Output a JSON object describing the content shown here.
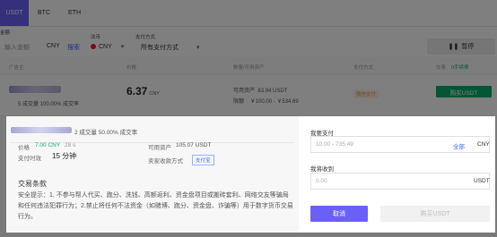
{
  "tabs": [
    "USDT",
    "BTC",
    "ETH"
  ],
  "filters": {
    "amount_label": "金额",
    "amount_placeholder": "输入金额",
    "amount_currency": "CNY",
    "search_label": "搜索",
    "fiat_label": "法币",
    "fiat_value": "CNY",
    "payment_label": "支付方式",
    "payment_value": "所有支付方式",
    "pause_label": "暂停"
  },
  "columns": {
    "advertiser": "广告主",
    "price": "价格",
    "available": "数量/可用资产",
    "payment": "支付方式",
    "action": "交易",
    "fee": "0手续费"
  },
  "row": {
    "orders": "5 成交量  100.00% 成交率",
    "price": "6.37",
    "price_unit": "CNY",
    "available_label": "可用资产",
    "available_value": "83.94 USDT",
    "limit_label": "限额",
    "limit_value": "￥100.00 - ￥534.69",
    "payment_badge": "微信支付",
    "buy_label": "购买USDT"
  },
  "modal": {
    "merchant_stats": "2 成交量  50.00% 成交率",
    "price_label": "价格",
    "price_value": "7.00 CNY",
    "price_time": "28 s",
    "pay_limit_label": "支付时效",
    "pay_limit_value": "15 分钟",
    "available_label": "可用资产",
    "available_value": "105.07 USDT",
    "seller_payment_label": "卖家收款方式",
    "seller_payment_value": "支付宝",
    "terms_title": "交易条款",
    "terms_body": "安全提示：1. 不参与帮人代买、跑分、洗钱、高额返利、资金盘项目或搬砖套利、网络交友等骗局和任何违法犯罪行为；2.禁止将任何不法资金（如赌博、跑分、资金盘、诈骗等）用于数字货币交易行为。",
    "pay_label": "我要支付",
    "pay_placeholder": "10.00 - 735.49",
    "pay_all": "全部",
    "pay_currency": "CNY",
    "receive_label": "我将收到",
    "receive_placeholder": "0.00",
    "receive_currency": "USDT",
    "cancel_label": "取消",
    "buy_label": "购买USDT"
  },
  "colors": {
    "accent": "#6a60f7",
    "green": "#0aad6d",
    "link": "#3d63f5"
  }
}
